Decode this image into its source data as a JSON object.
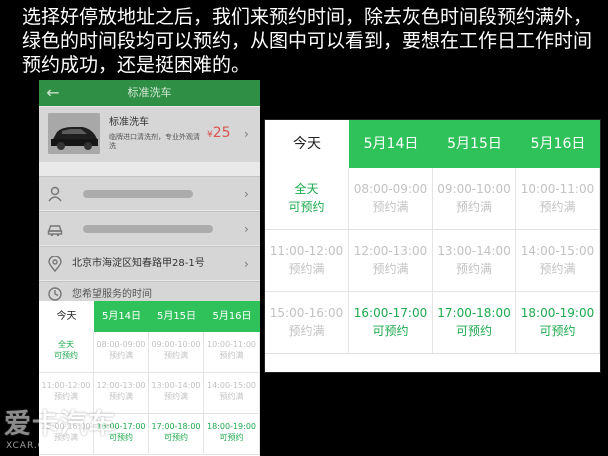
{
  "caption": {
    "lines": [
      "选择好停放地址之后，我们来预约时间，除去灰色时间段预约满外，",
      "绿色的时间段均可以预约，从图中可以看到，要想在工作日工作时间",
      "预约成功，还是挺困难的。"
    ]
  },
  "phone": {
    "back_icon": "arrow-left-icon",
    "title": "标准洗车",
    "service": {
      "name": "标准洗车",
      "description": "临牌进口清洗剂，专业外观清洗",
      "price_symbol": "¥",
      "price": "25"
    },
    "address": "北京市海淀区知春路甲28-1号",
    "service_time_placeholder": "您希望服务的时间",
    "colors": {
      "header_green": "#2f8f45",
      "overlay_gray": "#d6d6d6"
    }
  },
  "schedule": {
    "tabs": [
      "今天",
      "5月14日",
      "5月15日",
      "5月16日"
    ],
    "rows": [
      [
        {
          "time": "全天",
          "status": "可预约",
          "available": true
        },
        {
          "time": "08:00-09:00",
          "status": "预约满",
          "available": false
        },
        {
          "time": "09:00-10:00",
          "status": "预约满",
          "available": false
        },
        {
          "time": "10:00-11:00",
          "status": "预约满",
          "available": false
        }
      ],
      [
        {
          "time": "11:00-12:00",
          "status": "预约满",
          "available": false
        },
        {
          "time": "12:00-13:00",
          "status": "预约满",
          "available": false
        },
        {
          "time": "13:00-14:00",
          "status": "预约满",
          "available": false
        },
        {
          "time": "14:00-15:00",
          "status": "预约满",
          "available": false
        }
      ],
      [
        {
          "time": "15:00-16:00",
          "status": "预约满",
          "available": false
        },
        {
          "time": "16:00-17:00",
          "status": "可预约",
          "available": true
        },
        {
          "time": "17:00-18:00",
          "status": "可预约",
          "available": true
        },
        {
          "time": "18:00-19:00",
          "status": "可预约",
          "available": true
        }
      ]
    ],
    "colors": {
      "tab_green": "#2fc25b",
      "available_green": "#1daa4e",
      "full_gray": "#c2c2c2"
    }
  },
  "watermark": {
    "logo": "爱卡汽车",
    "url": "XCAR.COM.CN"
  }
}
